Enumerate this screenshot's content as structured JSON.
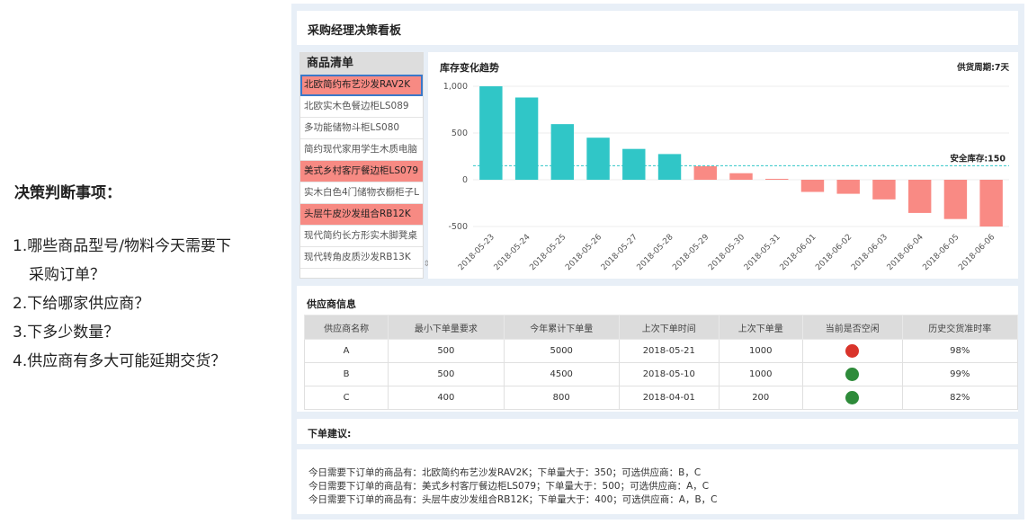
{
  "decision": {
    "heading": "决策判断事项：",
    "items": [
      {
        "line1": "1.哪些商品型号/物料今天需要下",
        "line2": "采购订单？"
      },
      {
        "line1": "2.下给哪家供应商？"
      },
      {
        "line1": "3.下多少数量？"
      },
      {
        "line1": "4.供应商有多大可能延期交货？"
      }
    ]
  },
  "dashboard": {
    "title": "采购经理决策看板",
    "product_list": {
      "header": "商品清单",
      "items": [
        {
          "label": "北欧简约布艺沙发RAV2K",
          "highlight": true,
          "selected": true
        },
        {
          "label": "北欧实木色餐边柜LS089",
          "highlight": false
        },
        {
          "label": "多功能储物斗柜LS080",
          "highlight": false
        },
        {
          "label": "简约现代家用学生木质电脑",
          "highlight": false
        },
        {
          "label": "美式乡村客厅餐边柜LS079",
          "highlight": true
        },
        {
          "label": "实木白色4门储物衣橱柜子L",
          "highlight": false
        },
        {
          "label": "头层牛皮沙发组合RB12K",
          "highlight": true
        },
        {
          "label": "现代简约长方形实木脚凳桌",
          "highlight": false
        },
        {
          "label": "现代转角皮质沙发RB13K",
          "highlight": false
        }
      ]
    },
    "chart_title": "库存变化趋势",
    "supply_cycle": "供货周期:7天",
    "safety_label": "安全库存:150",
    "suppliers": {
      "title": "供应商信息",
      "columns": [
        "供应商名称",
        "最小下单量要求",
        "今年累计下单量",
        "上次下单时间",
        "上次下单量",
        "当前是否空闲",
        "历史交货准时率"
      ],
      "rows": [
        {
          "name": "A",
          "min": "500",
          "ytd": "5000",
          "last_date": "2018-05-21",
          "last_qty": "1000",
          "status_color": "#d9342b",
          "rate": "98%"
        },
        {
          "name": "B",
          "min": "500",
          "ytd": "4500",
          "last_date": "2018-05-10",
          "last_qty": "1000",
          "status_color": "#2e8b3a",
          "rate": "99%"
        },
        {
          "name": "C",
          "min": "400",
          "ytd": "800",
          "last_date": "2018-04-01",
          "last_qty": "200",
          "status_color": "#2e8b3a",
          "rate": "82%"
        }
      ]
    },
    "suggestion": {
      "title": "下单建议:",
      "lines": [
        "今日需要下订单的商品有：北欧简约布艺沙发RAV2K；下单量大于：350；可选供应商：B，C",
        "今日需要下订单的商品有：美式乡村客厅餐边柜LS079；下单量大于：500；可选供应商：A，C",
        "今日需要下订单的商品有：头层牛皮沙发组合RB12K；下单量大于：400；可选供应商：A，B，C"
      ]
    }
  },
  "chart_data": {
    "type": "bar",
    "title": "库存变化趋势",
    "categories": [
      "2018-05-23",
      "2018-05-24",
      "2018-05-25",
      "2018-05-26",
      "2018-05-27",
      "2018-05-28",
      "2018-05-29",
      "2018-05-30",
      "2018-05-31",
      "2018-06-01",
      "2018-06-02",
      "2018-06-03",
      "2018-06-04",
      "2018-06-05",
      "2018-06-06"
    ],
    "values": [
      1000,
      880,
      595,
      450,
      330,
      275,
      145,
      70,
      10,
      -130,
      -150,
      -210,
      -355,
      -420,
      -500
    ],
    "ylim": [
      -500,
      1000
    ],
    "yticks": [
      -500,
      0,
      500,
      1000
    ],
    "ytick_labels": [
      "-500",
      "0",
      "500",
      "1,000"
    ],
    "safety_stock": 150,
    "colors": {
      "above_safety": "#30c6c7",
      "below_safety": "#f98a84",
      "safety_line": "#30c6c7"
    },
    "grid": true,
    "legend": "none"
  }
}
